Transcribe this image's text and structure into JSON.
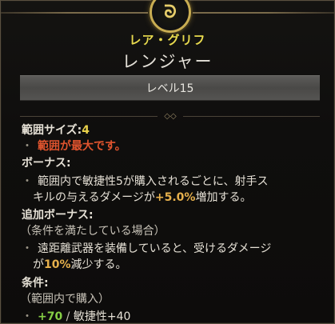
{
  "tooltip": {
    "rarity": "レア・グリフ",
    "name": "レンジャー",
    "level": "レベル15"
  },
  "stats": {
    "range_label": "範囲サイズ:",
    "range_value": "4",
    "range_max": "範囲が最大です。",
    "bonus_header": "ボーナス:",
    "bonus_line1_pre": "範囲内で敏捷性5が購入されるごとに、射手ス",
    "bonus_line2_pre": "キルの与えるダメージが",
    "bonus_value": "+5.0%",
    "bonus_line2_post": "増加する。",
    "extra_header": "追加ボーナス:",
    "extra_condition": "（条件を満たしている場合）",
    "extra_line1": "遠距離武器を装備していると、受けるダメージ",
    "extra_line2_pre": "が",
    "extra_value": "10%",
    "extra_line2_post": "減少する。",
    "req_header": "条件:",
    "req_condition": "（範囲内で購入）",
    "req_current": "+70",
    "req_sep": " / ",
    "req_target": "敏捷性+40"
  },
  "icons": {
    "emblem": "glyph-emblem-icon",
    "bullet": "bullet-icon"
  },
  "colors": {
    "rarity": "#e8da4e",
    "highlight_yellow": "#e8d04a",
    "warning_red": "#e0542e",
    "value_green": "#86cf45",
    "value_orange": "#e6b04c",
    "frame_gold": "#c9ad52"
  }
}
